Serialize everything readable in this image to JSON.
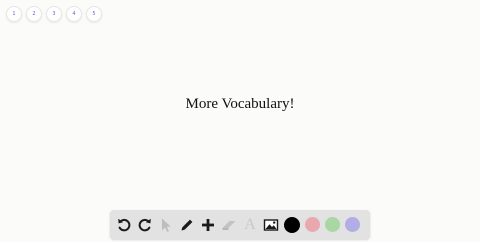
{
  "page_nav": {
    "pages": [
      "1",
      "2",
      "3",
      "4",
      "5"
    ]
  },
  "slide": {
    "text": "More Vocabulary!"
  },
  "toolbar": {
    "tools": [
      {
        "name": "undo-icon",
        "enabled": true
      },
      {
        "name": "redo-icon",
        "enabled": true
      },
      {
        "name": "select-pointer-icon",
        "enabled": false
      },
      {
        "name": "pencil-icon",
        "enabled": true
      },
      {
        "name": "add-plus-icon",
        "enabled": true
      },
      {
        "name": "eraser-icon",
        "enabled": false
      },
      {
        "name": "text-icon",
        "enabled": false
      },
      {
        "name": "image-icon",
        "enabled": true
      }
    ],
    "text_tool_glyph": "A",
    "colors": {
      "black": "#000000",
      "red": "#e8a8ad",
      "green": "#a8d7a3",
      "purple": "#b2ade6"
    }
  }
}
